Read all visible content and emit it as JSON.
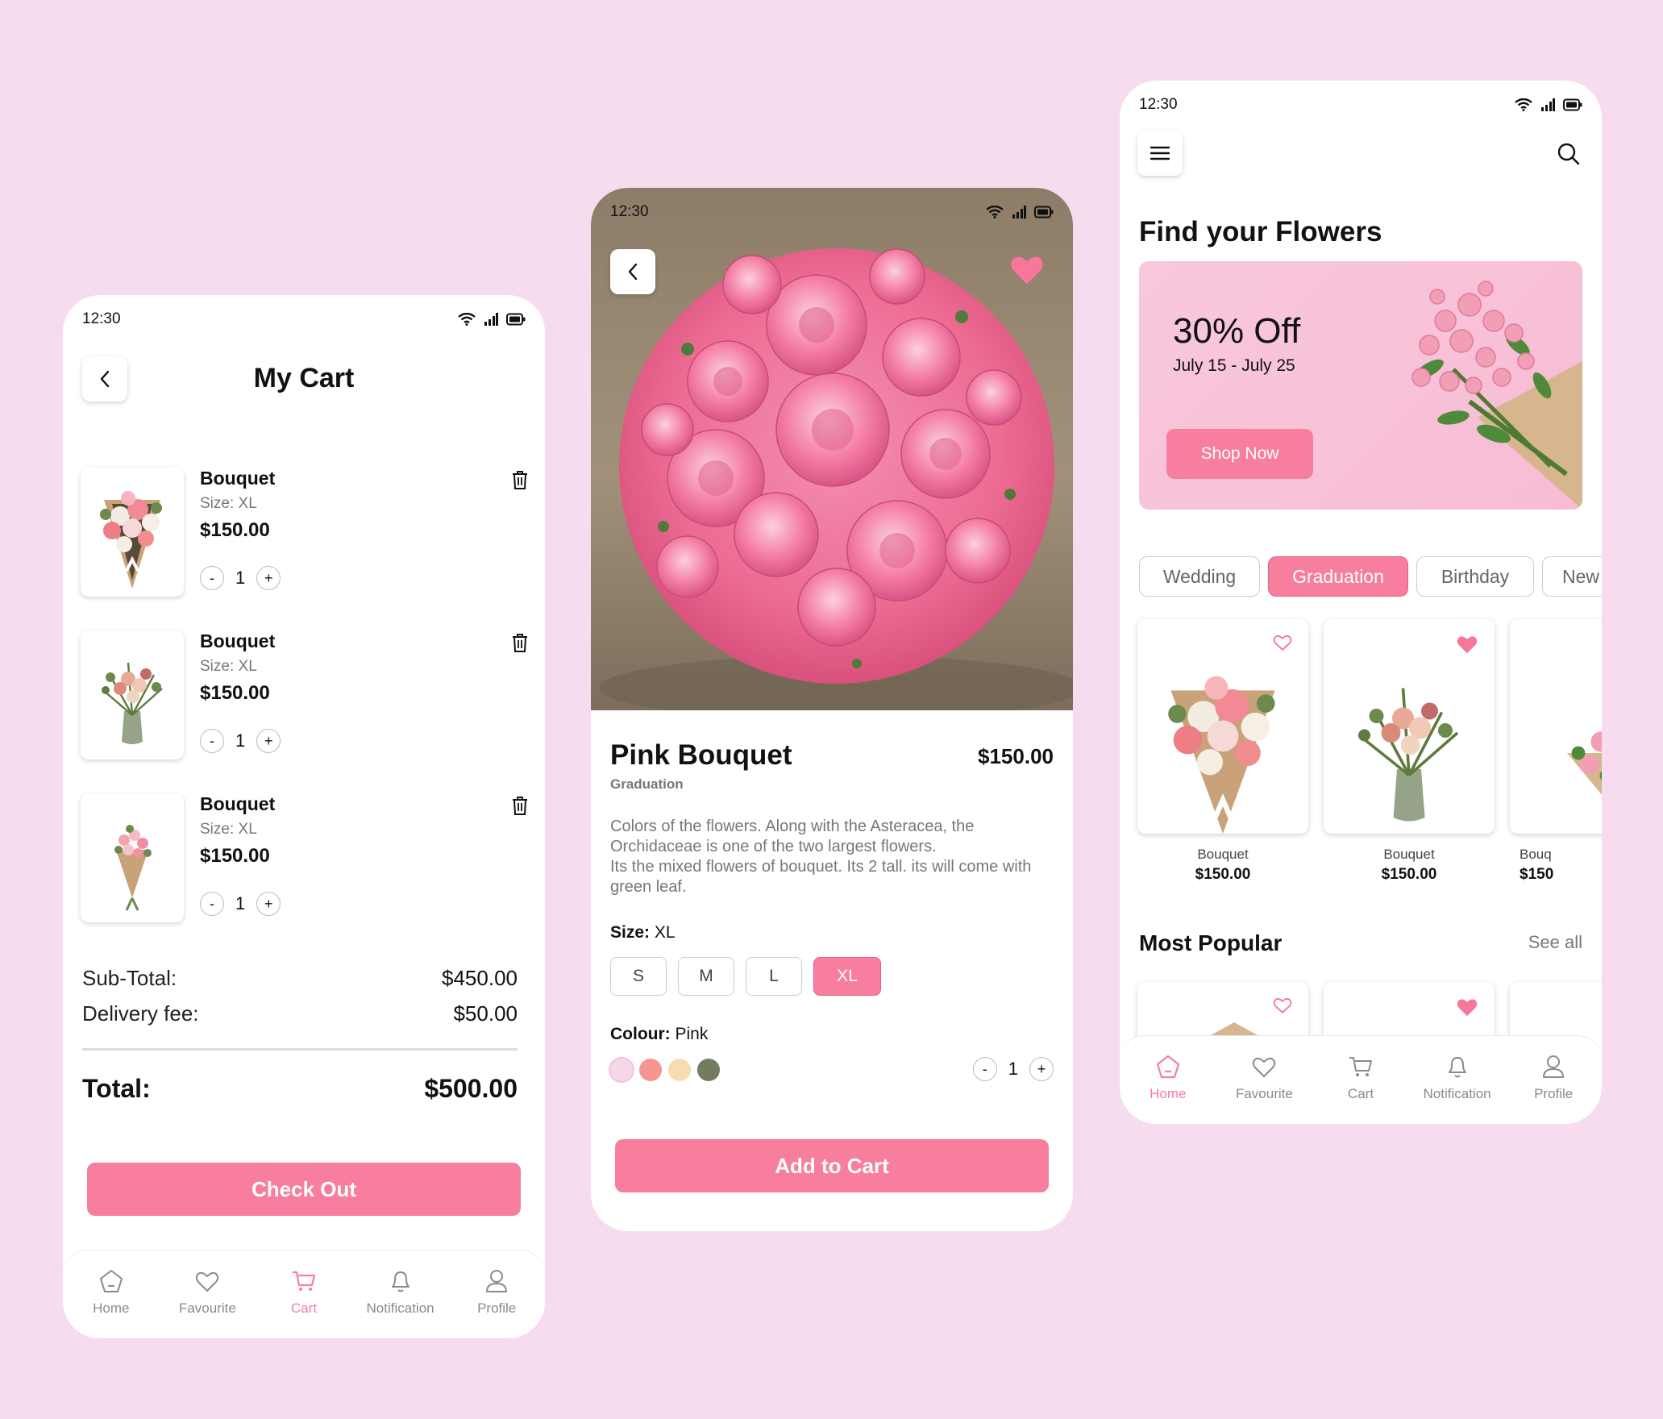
{
  "status_time": "12:30",
  "colors": {
    "accent": "#f77e9c",
    "background": "#f7dcef"
  },
  "cart": {
    "title": "My Cart",
    "items": [
      {
        "name": "Bouquet",
        "size": "Size: XL",
        "price": "$150.00",
        "qty": "1"
      },
      {
        "name": "Bouquet",
        "size": "Size: XL",
        "price": "$150.00",
        "qty": "1"
      },
      {
        "name": "Bouquet",
        "size": "Size: XL",
        "price": "$150.00",
        "qty": "1"
      }
    ],
    "subtotal_label": "Sub-Total:",
    "subtotal_value": "$450.00",
    "delivery_label": "Delivery fee:",
    "delivery_value": "$50.00",
    "total_label": "Total:",
    "total_value": "$500.00",
    "checkout_label": "Check Out"
  },
  "detail": {
    "name": "Pink Bouquet",
    "price": "$150.00",
    "category": "Graduation",
    "description": "Colors of the flowers. Along with the Asteracea, the Orchidaceae is one of the two largest flowers.\nIts the mixed flowers of bouquet. Its 2 tall. its will come with green leaf.",
    "size_label": "Size:",
    "size_value": "XL",
    "sizes": [
      "S",
      "M",
      "L",
      "XL"
    ],
    "colour_label": "Colour:",
    "colour_value": "Pink",
    "swatches": [
      "#f6d7ea",
      "#f6958f",
      "#f8dbb3",
      "#737c5e"
    ],
    "qty": "1",
    "add_label": "Add to Cart"
  },
  "home": {
    "title": "Find your Flowers",
    "promo_title": "30% Off",
    "promo_dates": "July 15 - July 25",
    "promo_button": "Shop Now",
    "categories": [
      "Wedding",
      "Graduation",
      "Birthday",
      "New"
    ],
    "products": [
      {
        "name": "Bouquet",
        "price": "$150.00"
      },
      {
        "name": "Bouquet",
        "price": "$150.00"
      },
      {
        "name": "Bouq",
        "price": "$150"
      }
    ],
    "popular_title": "Most Popular",
    "see_all": "See all"
  },
  "nav": [
    "Home",
    "Favourite",
    "Cart",
    "Notification",
    "Profile"
  ]
}
